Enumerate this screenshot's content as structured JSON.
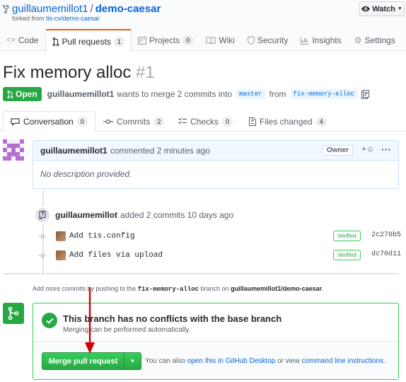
{
  "repo": {
    "owner": "guillaumemillot1",
    "name": "demo-caesar",
    "forked_prefix": "forked from",
    "forked_from": "tis-cv/demo-caesar",
    "watch_label": "Watch"
  },
  "tabs": [
    {
      "label": "Code",
      "icon": "code-icon"
    },
    {
      "label": "Pull requests",
      "count": "1",
      "icon": "pull-request-icon"
    },
    {
      "label": "Projects",
      "count": "0",
      "icon": "project-icon"
    },
    {
      "label": "Wiki",
      "icon": "book-icon"
    },
    {
      "label": "Security",
      "icon": "shield-icon"
    },
    {
      "label": "Insights",
      "icon": "graph-icon"
    },
    {
      "label": "Settings",
      "icon": "gear-icon"
    }
  ],
  "pr": {
    "title": "Fix memory alloc",
    "number": "#1",
    "state": "Open",
    "author": "guillaumemillot1",
    "merge_text_1": "wants to merge 2 commits into",
    "base_branch": "master",
    "from_text": "from",
    "head_branch": "fix-memory-alloc"
  },
  "pr_tabs": [
    {
      "label": "Conversation",
      "count": "0"
    },
    {
      "label": "Commits",
      "count": "2"
    },
    {
      "label": "Checks",
      "count": "0"
    },
    {
      "label": "Files changed",
      "count": "4"
    }
  ],
  "comment": {
    "author": "guillaumemillot1",
    "action": "commented 2 minutes ago",
    "badge": "Owner",
    "body": "No description provided."
  },
  "timeline": {
    "author": "guillaumemillot",
    "action": "added 2 commits 10 days ago",
    "commits": [
      {
        "message": "Add tis.config",
        "verified": "Verified",
        "sha": "2c270b5"
      },
      {
        "message": "Add files via upload",
        "verified": "Verified",
        "sha": "dc70d11"
      }
    ]
  },
  "push_hint": {
    "prefix": "Add more commits by pushing to the",
    "branch": "fix-memory-alloc",
    "middle": "branch on",
    "repo": "guillaumemillot1/demo-caesar",
    "suffix": "."
  },
  "merge": {
    "title": "This branch has no conflicts with the base branch",
    "subtitle": "Merging can be performed automatically.",
    "button": "Merge pull request",
    "hint_prefix": "You can also",
    "hint_link1": "open this in GitHub Desktop",
    "hint_middle": "or view",
    "hint_link2": "command line instructions",
    "hint_suffix": "."
  },
  "colors": {
    "open_green": "#28a745",
    "link_blue": "#0366d6",
    "tab_accent": "#e36209",
    "annotation_red": "#d40000"
  }
}
